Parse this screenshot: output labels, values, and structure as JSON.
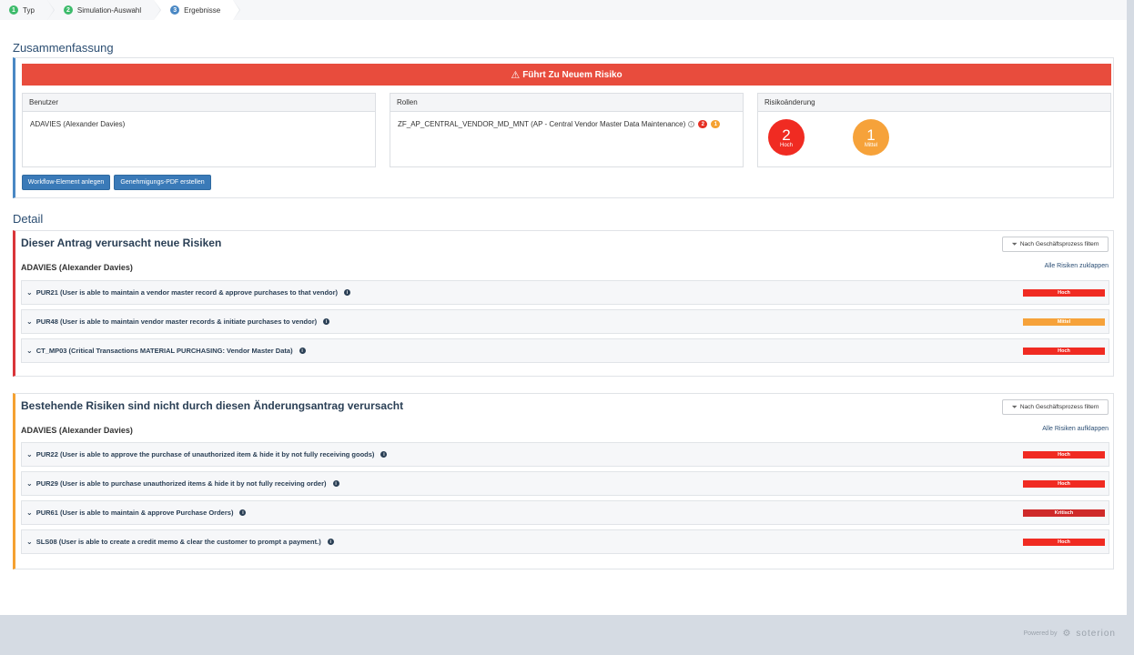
{
  "steps": [
    {
      "num": "1",
      "label": "Typ"
    },
    {
      "num": "2",
      "label": "Simulation-Auswahl"
    },
    {
      "num": "3",
      "label": "Ergebnisse"
    }
  ],
  "summary": {
    "title": "Zusammenfassung",
    "alert": "Führt Zu Neuem Risiko",
    "panels": {
      "user": {
        "head": "Benutzer",
        "value": "ADAVIES (Alexander Davies)"
      },
      "roles": {
        "head": "Rollen",
        "value": "ZF_AP_CENTRAL_VENDOR_MD_MNT (AP - Central Vendor Master Data Maintenance)",
        "badge_red": "2",
        "badge_orange": "1"
      },
      "risk_change": {
        "head": "Risikoänderung",
        "high_count": "2",
        "high_label": "Hoch",
        "medium_count": "1",
        "medium_label": "Mittel"
      }
    },
    "buttons": {
      "workflow": "Workflow-Element anlegen",
      "pdf": "Genehmigungs-PDF erstellen"
    }
  },
  "detail": {
    "title": "Detail",
    "new_risks": {
      "title": "Dieser Antrag verursacht neue Risiken",
      "filter": "Nach Geschäftsprozess filtern",
      "user": "ADAVIES (Alexander Davies)",
      "toggle": "Alle Risiken zuklappen",
      "rows": [
        {
          "text": "PUR21 (User is able to maintain a vendor master record & approve purchases to that vendor)",
          "level": "Hoch"
        },
        {
          "text": "PUR48 (User is able to maintain vendor master records & initiate purchases to vendor)",
          "level": "Mittel"
        },
        {
          "text": "CT_MP03 (Critical Transactions MATERIAL PURCHASING: Vendor Master Data)",
          "level": "Hoch"
        }
      ]
    },
    "existing_risks": {
      "title": "Bestehende Risiken sind nicht durch diesen Änderungsantrag verursacht",
      "filter": "Nach Geschäftsprozess filtern",
      "user": "ADAVIES (Alexander Davies)",
      "toggle": "Alle Risiken aufklappen",
      "rows": [
        {
          "text": "PUR22 (User is able to approve the purchase of unauthorized item & hide it by not fully receiving goods)",
          "level": "Hoch"
        },
        {
          "text": "PUR29 (User is able to purchase unauthorized items & hide it by not fully receiving order)",
          "level": "Hoch"
        },
        {
          "text": "PUR61 (User is able to maintain & approve Purchase Orders)",
          "level": "Kritisch"
        },
        {
          "text": "SLS08 (User is able to create a credit memo & clear the customer to prompt a payment.)",
          "level": "Hoch"
        }
      ]
    }
  },
  "footer": {
    "powered_by": "Powered by",
    "brand": "soterion"
  },
  "colors": {
    "high": "#f02b22",
    "medium": "#f6a23a",
    "critical": "#cf2a2a",
    "alert": "#e84c3d",
    "primary": "#3a7ab8"
  }
}
